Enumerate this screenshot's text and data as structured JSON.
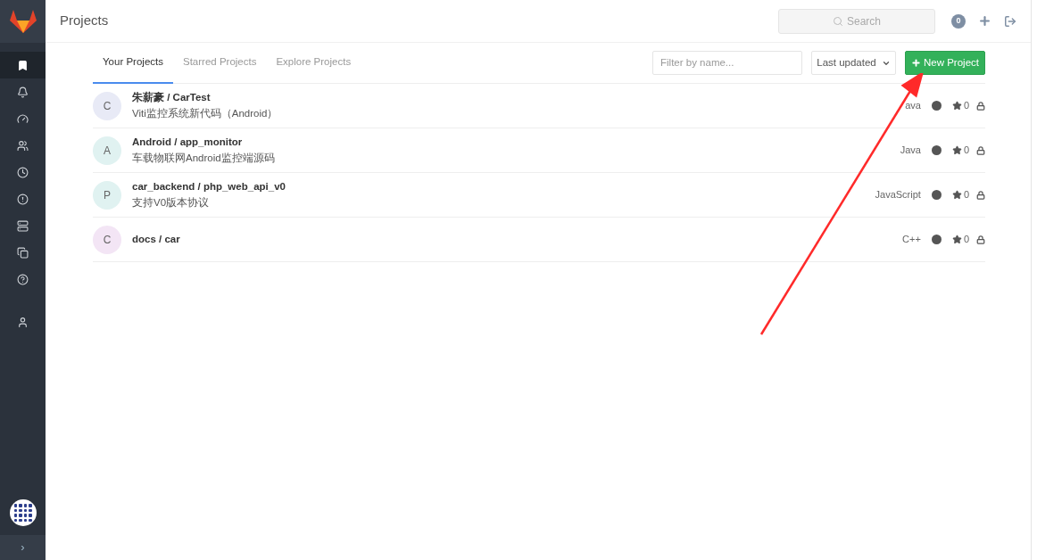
{
  "sidebar": {
    "items": [
      {
        "kind": "bookmark",
        "selected": true
      },
      {
        "kind": "bell",
        "selected": false
      },
      {
        "kind": "gauge",
        "selected": false
      },
      {
        "kind": "users",
        "selected": false
      },
      {
        "kind": "clock",
        "selected": false
      },
      {
        "kind": "alert",
        "selected": false
      },
      {
        "kind": "server",
        "selected": false
      },
      {
        "kind": "copy",
        "selected": false
      },
      {
        "kind": "help",
        "selected": false
      },
      {
        "kind": "user",
        "selected": false
      }
    ],
    "collapse": "›"
  },
  "header": {
    "title": "Projects",
    "search": {
      "placeholder": "Search"
    },
    "todo_count": "0"
  },
  "tabs": [
    {
      "label": "Your Projects",
      "selected": true
    },
    {
      "label": "Starred Projects",
      "selected": false
    },
    {
      "label": "Explore Projects",
      "selected": false
    }
  ],
  "filter": {
    "placeholder": "Filter by name..."
  },
  "sort": {
    "label": "Last updated"
  },
  "new_button": "New Project",
  "projects": [
    {
      "initial": "C",
      "color": "#e8eaf6",
      "name": "朱薪豪 / CarTest",
      "description": "Viti监控系统新代码（Android）",
      "language": "ava",
      "stars": "0"
    },
    {
      "initial": "A",
      "color": "#e0f2f1",
      "name": "Android / app_monitor",
      "description": "车载物联网Android监控端源码",
      "language": "Java",
      "stars": "0"
    },
    {
      "initial": "P",
      "color": "#e0f2f1",
      "name": "car_backend / php_web_api_v0",
      "description": "支持V0版本协议",
      "language": "JavaScript",
      "stars": "0"
    },
    {
      "initial": "C",
      "color": "#f3e5f5",
      "name": "docs / car",
      "language": "C++",
      "stars": "0"
    }
  ]
}
